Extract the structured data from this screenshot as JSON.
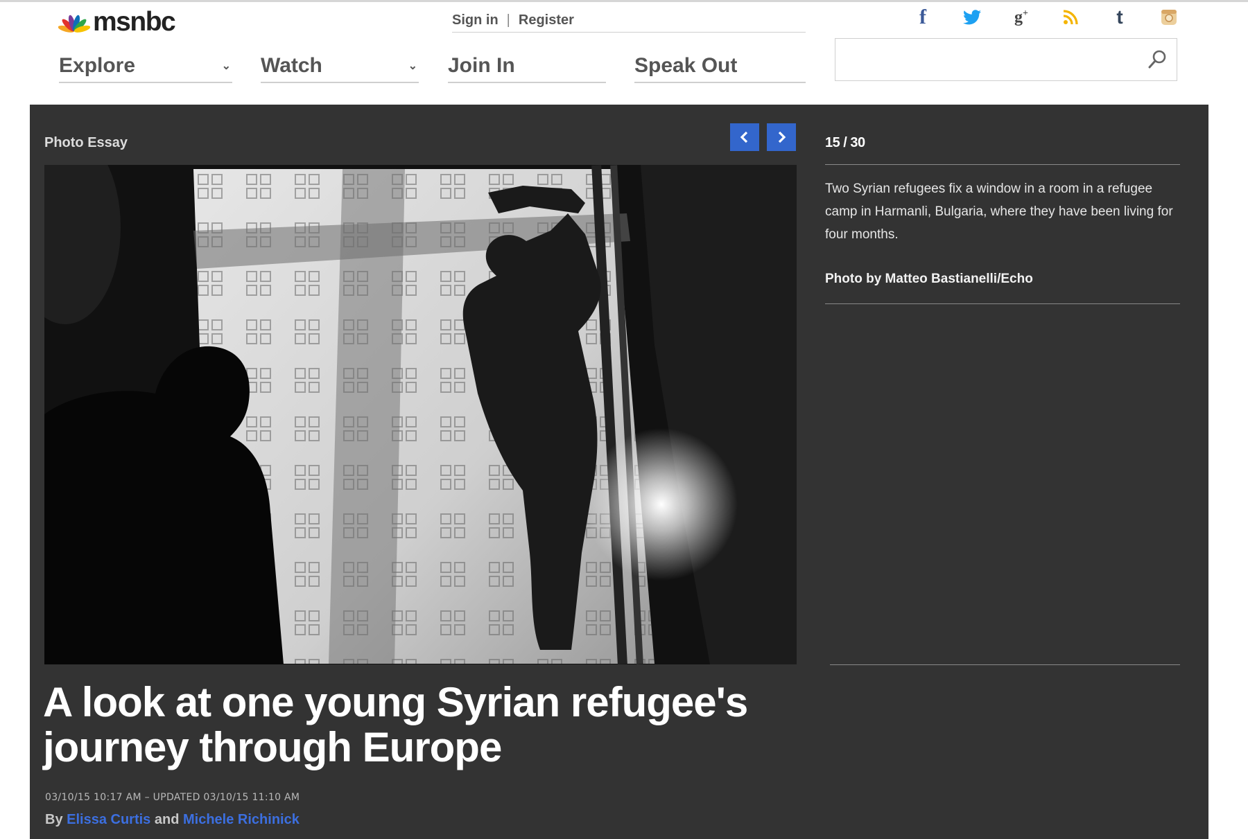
{
  "header": {
    "logo_text": "msnbc",
    "sign_in": "Sign in",
    "separator": "|",
    "register": "Register",
    "nav": [
      {
        "label": "Explore"
      },
      {
        "label": "Watch"
      },
      {
        "label": "Join In"
      },
      {
        "label": "Speak Out"
      }
    ],
    "social": [
      {
        "name": "facebook-icon",
        "glyph": "f",
        "color": "#3b5998"
      },
      {
        "name": "twitter-icon",
        "glyph": "twitter",
        "color": "#1da1f2"
      },
      {
        "name": "google-plus-icon",
        "glyph": "g+",
        "color": "#444444"
      },
      {
        "name": "rss-icon",
        "glyph": "rss",
        "color": "#f4b400"
      },
      {
        "name": "tumblr-icon",
        "glyph": "t",
        "color": "#35465c"
      },
      {
        "name": "instagram-icon",
        "glyph": "camera",
        "color": "#e3c08a"
      }
    ],
    "search": {
      "value": "",
      "placeholder": ""
    }
  },
  "article": {
    "section_label": "Photo Essay",
    "headline_line1": "A look at one young Syrian refugee's",
    "headline_line2": "journey through Europe",
    "dateline": "03/10/15 10:17 AM – UPDATED 03/10/15 11:10 AM",
    "byline_prefix": "By",
    "author1": "Elissa Curtis",
    "byline_and": "and",
    "author2": "Michele Richinick"
  },
  "gallery": {
    "counter": "15 / 30",
    "current": 15,
    "total": 30,
    "caption": "Two Syrian refugees fix a window in a room in a refugee camp in Harmanli, Bulgaria, where they have been living for four months.",
    "credit": "Photo by Matteo Bastianelli/Echo"
  },
  "colors": {
    "panel_bg": "#333333",
    "accent_blue": "#3366cc",
    "link_blue": "#3c6fe0"
  }
}
